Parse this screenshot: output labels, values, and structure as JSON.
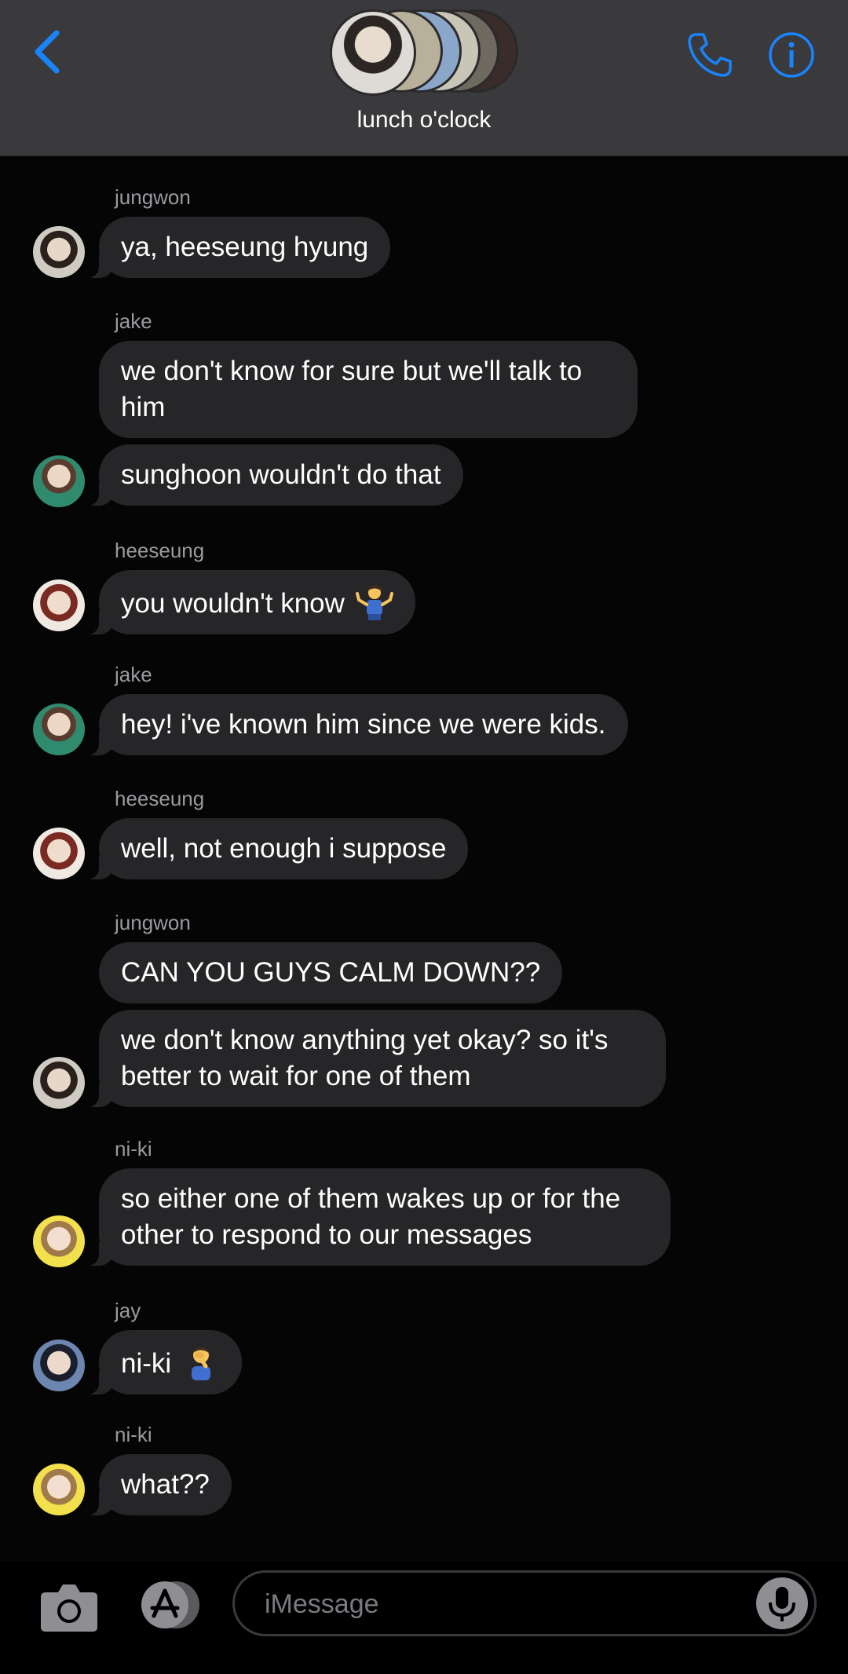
{
  "header": {
    "group_name": "lunch o'clock",
    "accent_color": "#1a84ff"
  },
  "messages": [
    {
      "sender": "jungwon",
      "texts": [
        "ya, heeseung hyung"
      ]
    },
    {
      "sender": "jake",
      "texts": [
        "we don't know for sure but we'll talk to him",
        "sunghoon wouldn't do that"
      ]
    },
    {
      "sender": "heeseung",
      "texts": [
        "you wouldn't know"
      ],
      "emoji": "person-shrugging"
    },
    {
      "sender": "jake",
      "texts": [
        "hey! i've known him since we were kids."
      ]
    },
    {
      "sender": "heeseung",
      "texts": [
        "well, not enough i suppose"
      ]
    },
    {
      "sender": "jungwon",
      "texts": [
        "CAN YOU GUYS CALM DOWN??",
        "we don't know anything yet okay? so it's better to wait for one of them"
      ]
    },
    {
      "sender": "ni-ki",
      "texts": [
        "so either one of them wakes up or for the other to respond to our messages"
      ]
    },
    {
      "sender": "jay",
      "texts": [
        "ni-ki"
      ],
      "emoji": "person-facepalming"
    },
    {
      "sender": "ni-ki",
      "texts": [
        "what??"
      ]
    }
  ],
  "composer": {
    "placeholder": "iMessage"
  },
  "icons": [
    "back-chevron-icon",
    "phone-icon",
    "info-icon",
    "camera-icon",
    "app-store-icon",
    "microphone-icon"
  ]
}
